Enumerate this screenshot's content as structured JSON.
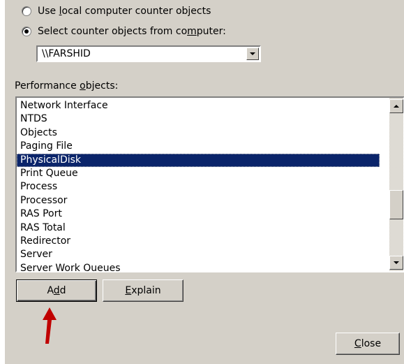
{
  "radios": [
    {
      "label_pre": "Use ",
      "label_key": "l",
      "label_post": "ocal computer counter objects",
      "checked": false
    },
    {
      "label_pre": "Select counter objects from co",
      "label_key": "m",
      "label_post": "puter:",
      "checked": true
    }
  ],
  "computer_combo": {
    "value": "\\\\FARSHID"
  },
  "performance_objects": {
    "label_pre": "Performance ",
    "label_key": "o",
    "label_post": "bjects:",
    "items": [
      "Network Interface",
      "NTDS",
      "Objects",
      "Paging File",
      "PhysicalDisk",
      "Print Queue",
      "Process",
      "Processor",
      "RAS Port",
      "RAS Total",
      "Redirector",
      "Server",
      "Server Work Queues"
    ],
    "selected": "PhysicalDisk"
  },
  "buttons": {
    "add": {
      "pre": "A",
      "key": "d",
      "post": "d"
    },
    "explain": {
      "pre": "",
      "key": "E",
      "post": "xplain"
    },
    "close": {
      "pre": "",
      "key": "C",
      "post": "lose"
    }
  },
  "colors": {
    "selection": "#0a246a",
    "dialog": "#d4d0c8",
    "annotation_arrow": "#c00000"
  },
  "icons": {
    "scroll_up": "triangle-up",
    "scroll_down": "triangle-down",
    "combo_dropdown": "triangle-down",
    "annotation": "red-arrow-up"
  }
}
